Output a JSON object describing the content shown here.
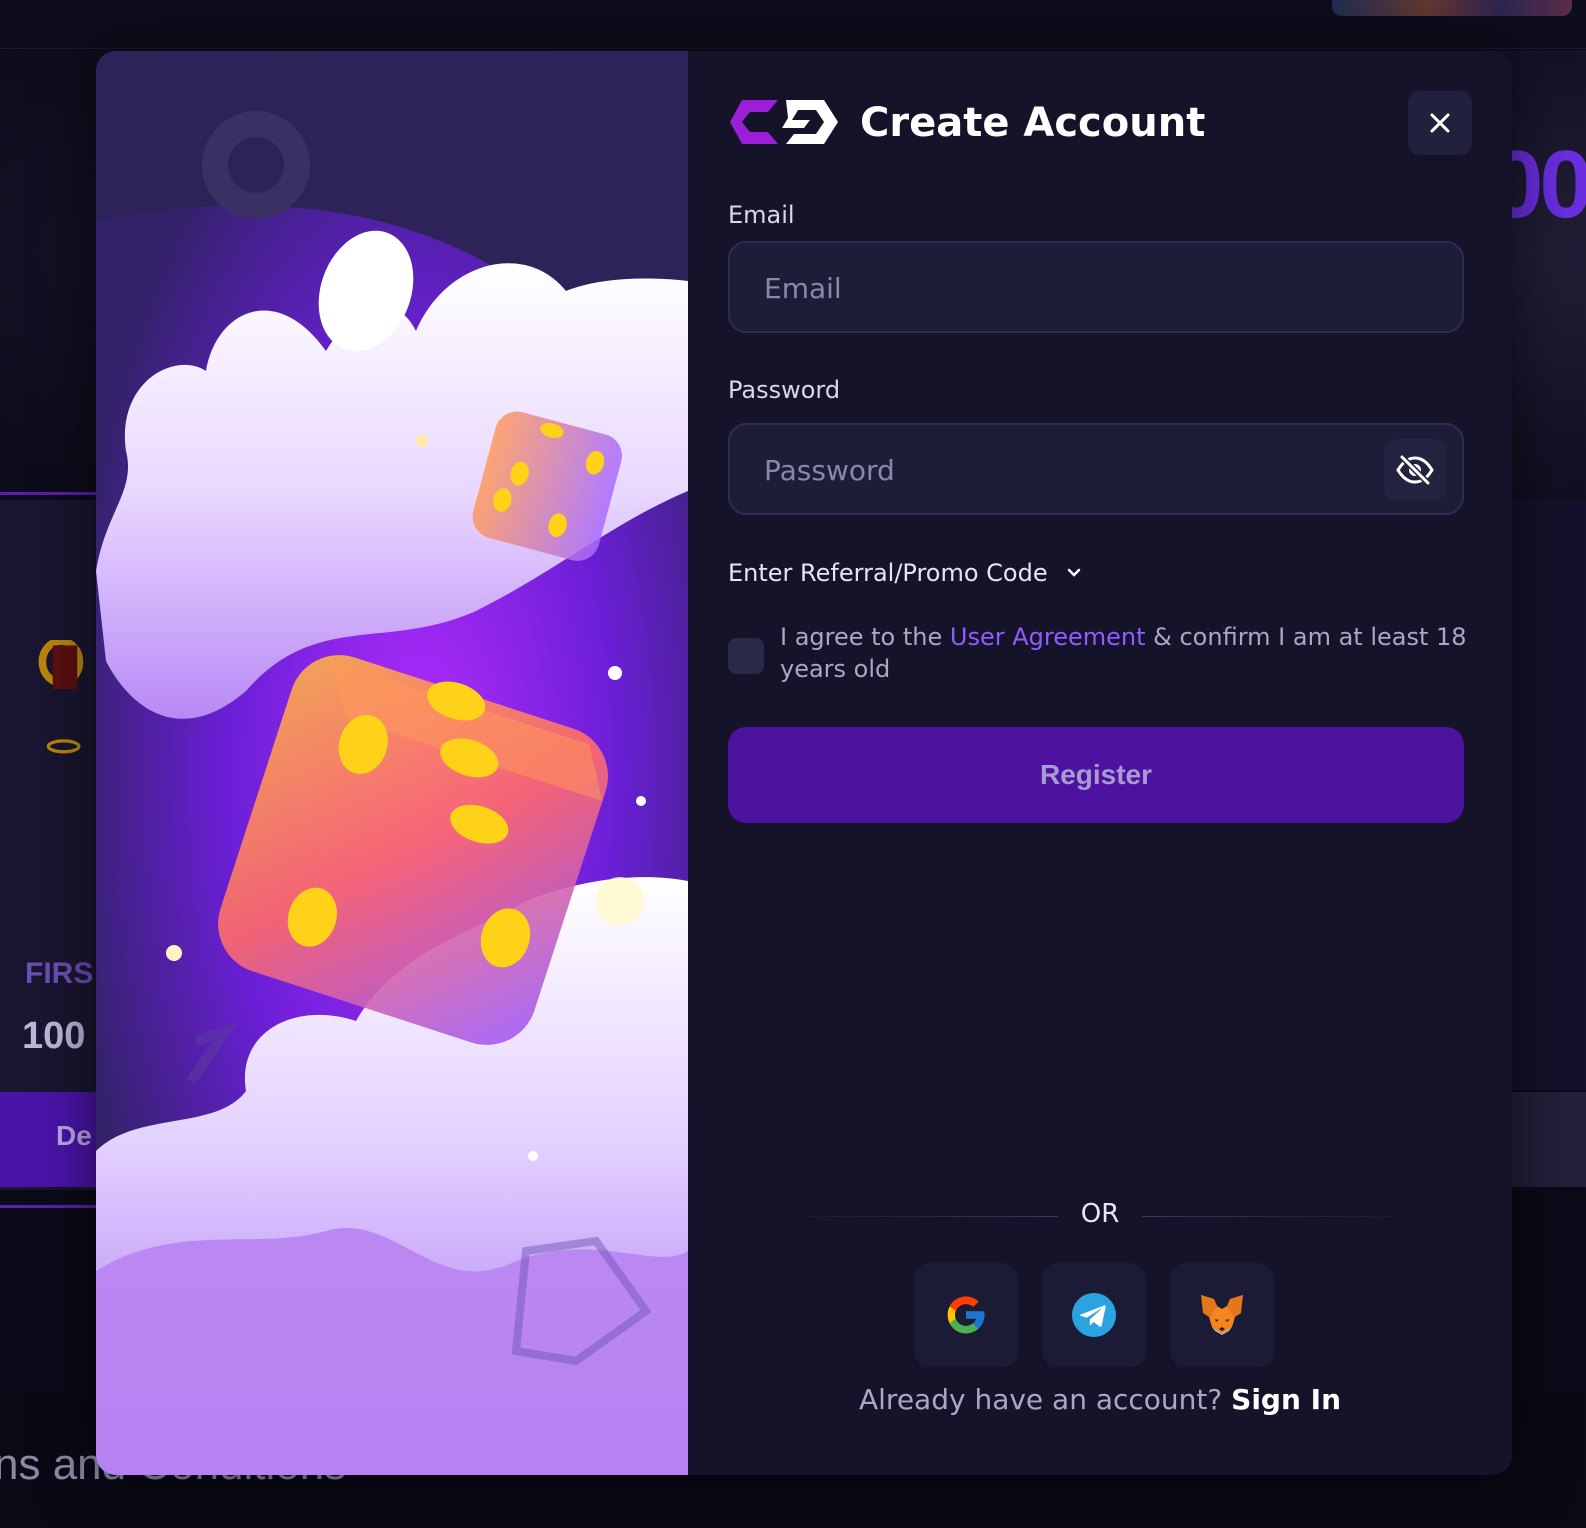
{
  "background": {
    "hero_digits": "00",
    "promo_title": "FIRS",
    "promo_amount": "100",
    "deposit_label": "De",
    "terms_text": "ns and Conditions"
  },
  "modal": {
    "title": "Create Account",
    "email": {
      "label": "Email",
      "placeholder": "Email",
      "value": ""
    },
    "password": {
      "label": "Password",
      "placeholder": "Password",
      "value": ""
    },
    "promo_toggle": "Enter Referral/Promo Code",
    "agreement": {
      "prefix": "I agree to the ",
      "link": "User Agreement",
      "suffix": " & confirm I am at least 18 years old"
    },
    "register_label": "Register",
    "divider_text": "OR",
    "social": [
      {
        "icon": "google-icon"
      },
      {
        "icon": "telegram-icon"
      },
      {
        "icon": "metamask-icon"
      }
    ],
    "signin_prompt": "Already have an account?",
    "signin_link": "Sign In"
  },
  "colors": {
    "accent": "#8f5cff",
    "primary_button": "#4d13a0",
    "panel_bg": "#14132a",
    "input_bg": "#1e1d38"
  }
}
